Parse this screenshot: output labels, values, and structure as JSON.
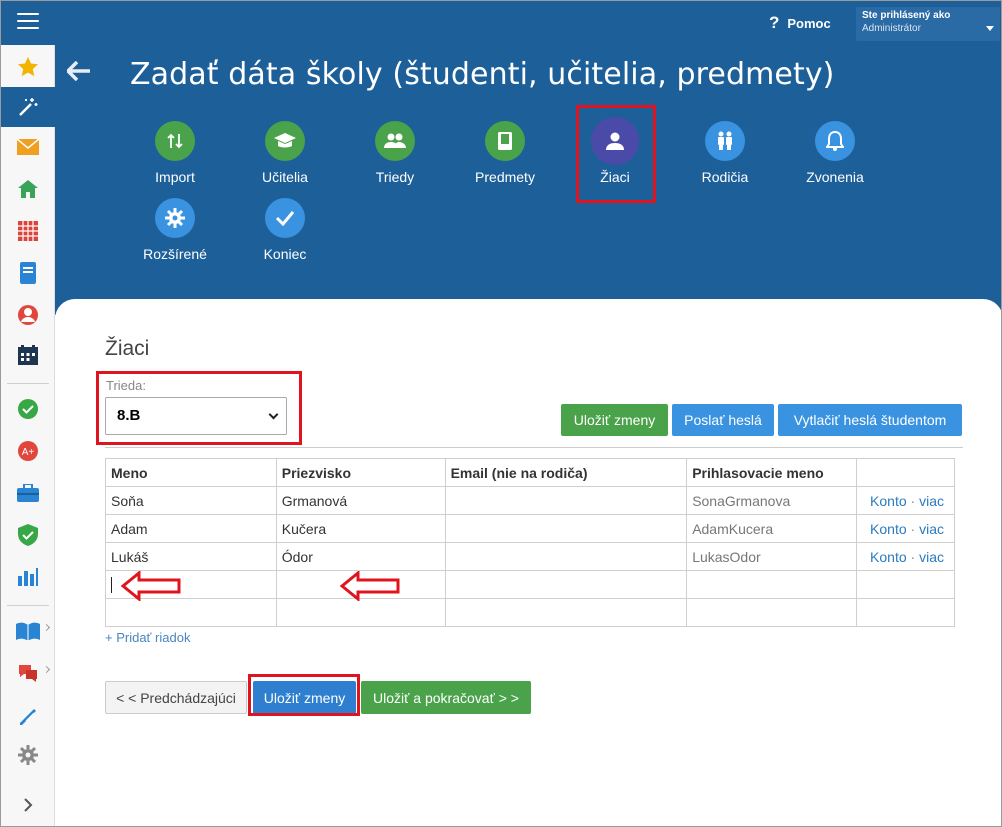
{
  "topbar": {
    "help_label": "Pomoc",
    "login_line1": "Ste prihlásený ako",
    "login_line2": "Administrátor"
  },
  "header": {
    "title": "Zadať dáta školy (študenti, učitelia, predmety)"
  },
  "steps": [
    {
      "label": "Import",
      "icon": "sort-arrows-icon",
      "color": "#4aa34a"
    },
    {
      "label": "Učitelia",
      "icon": "graduation-cap-icon",
      "color": "#4aa34a"
    },
    {
      "label": "Triedy",
      "icon": "people-icon",
      "color": "#4aa34a"
    },
    {
      "label": "Predmety",
      "icon": "book-icon",
      "color": "#4aa34a"
    },
    {
      "label": "Žiaci",
      "icon": "user-icon",
      "color": "#4a4aa8"
    },
    {
      "label": "Rodičia",
      "icon": "parents-icon",
      "color": "#3a93e0"
    },
    {
      "label": "Zvonenia",
      "icon": "bell-icon",
      "color": "#3a93e0"
    },
    {
      "label": "Rozšírené",
      "icon": "gear-icon",
      "color": "#3a93e0"
    },
    {
      "label": "Koniec",
      "icon": "check-icon",
      "color": "#3a93e0"
    }
  ],
  "main": {
    "section_title": "Žiaci",
    "class_label": "Trieda:",
    "class_value": "8.B",
    "buttons": {
      "save": "Uložiť zmeny",
      "send_passwords": "Poslať heslá",
      "print_passwords": "Vytlačiť heslá študentom"
    },
    "table": {
      "headers": [
        "Meno",
        "Priezvisko",
        "Email (nie na rodiča)",
        "Prihlasovacie meno",
        ""
      ],
      "rows": [
        {
          "first": "Soňa",
          "last": "Grmanová",
          "email": "",
          "login": "SonaGrmanova",
          "link1": "Konto",
          "link2": "viac"
        },
        {
          "first": "Adam",
          "last": "Kučera",
          "email": "",
          "login": "AdamKucera",
          "link1": "Konto",
          "link2": "viac"
        },
        {
          "first": "Lukáš",
          "last": "Ódor",
          "email": "",
          "login": "LukasOdor",
          "link1": "Konto",
          "link2": "viac"
        }
      ],
      "link_separator": "·"
    },
    "add_row": "+ Pridať riadok",
    "bottom_buttons": {
      "previous": "< < Predchádzajúci",
      "save": "Uložiť zmeny",
      "save_continue": "Uložiť a pokračovať > >"
    }
  },
  "sidebar_icons": [
    "star-icon",
    "magic-wand-icon",
    "mail-icon",
    "home-icon",
    "calendar-grid-icon",
    "notebook-icon",
    "person-icon",
    "schedule-icon",
    "check-circle-icon",
    "grade-icon",
    "briefcase-icon",
    "shield-check-icon",
    "bar-chart-icon",
    "open-book-icon",
    "chat-icon",
    "pen-icon",
    "settings-icon",
    "expand-icon"
  ],
  "colors": {
    "brand_blue": "#1d5f99",
    "green": "#4aa34a",
    "blue": "#3a93e0",
    "purple": "#4a4aa8",
    "highlight_red": "#e0141e"
  }
}
